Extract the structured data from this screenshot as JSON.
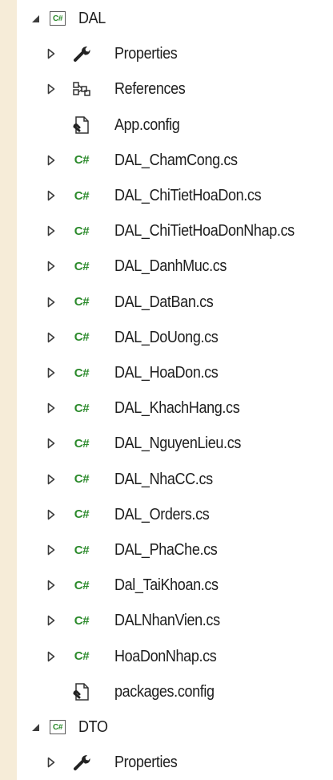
{
  "tree": {
    "dal_project": {
      "label": "DAL",
      "icon": "csharp-project-icon",
      "expanded": true
    },
    "dal_children": [
      {
        "label": "Properties",
        "icon": "wrench-icon",
        "expander": "collapsed"
      },
      {
        "label": "References",
        "icon": "references-icon",
        "expander": "collapsed"
      },
      {
        "label": "App.config",
        "icon": "config-file-icon",
        "expander": "none"
      },
      {
        "label": "DAL_ChamCong.cs",
        "icon": "csharp-file-icon",
        "expander": "collapsed"
      },
      {
        "label": "DAL_ChiTietHoaDon.cs",
        "icon": "csharp-file-icon",
        "expander": "collapsed"
      },
      {
        "label": "DAL_ChiTietHoaDonNhap.cs",
        "icon": "csharp-file-icon",
        "expander": "collapsed"
      },
      {
        "label": "DAL_DanhMuc.cs",
        "icon": "csharp-file-icon",
        "expander": "collapsed"
      },
      {
        "label": "DAL_DatBan.cs",
        "icon": "csharp-file-icon",
        "expander": "collapsed"
      },
      {
        "label": "DAL_DoUong.cs",
        "icon": "csharp-file-icon",
        "expander": "collapsed"
      },
      {
        "label": "DAL_HoaDon.cs",
        "icon": "csharp-file-icon",
        "expander": "collapsed"
      },
      {
        "label": "DAL_KhachHang.cs",
        "icon": "csharp-file-icon",
        "expander": "collapsed"
      },
      {
        "label": "DAL_NguyenLieu.cs",
        "icon": "csharp-file-icon",
        "expander": "collapsed"
      },
      {
        "label": "DAL_NhaCC.cs",
        "icon": "csharp-file-icon",
        "expander": "collapsed"
      },
      {
        "label": "DAL_Orders.cs",
        "icon": "csharp-file-icon",
        "expander": "collapsed"
      },
      {
        "label": "DAL_PhaChe.cs",
        "icon": "csharp-file-icon",
        "expander": "collapsed"
      },
      {
        "label": "Dal_TaiKhoan.cs",
        "icon": "csharp-file-icon",
        "expander": "collapsed"
      },
      {
        "label": "DALNhanVien.cs",
        "icon": "csharp-file-icon",
        "expander": "collapsed"
      },
      {
        "label": "HoaDonNhap.cs",
        "icon": "csharp-file-icon",
        "expander": "collapsed"
      },
      {
        "label": "packages.config",
        "icon": "config-file-icon",
        "expander": "none"
      }
    ],
    "dto_project": {
      "label": "DTO",
      "icon": "csharp-project-icon",
      "expanded": true
    },
    "dto_children": [
      {
        "label": "Properties",
        "icon": "wrench-icon",
        "expander": "collapsed"
      }
    ]
  },
  "glyphs": {
    "csharp_short": "C#"
  },
  "colors": {
    "background": "#f6ecd8",
    "panel": "#ffffff",
    "text": "#1e1e1e",
    "csharp_green": "#2b8a2b",
    "arrow": "#3c3c3c"
  }
}
